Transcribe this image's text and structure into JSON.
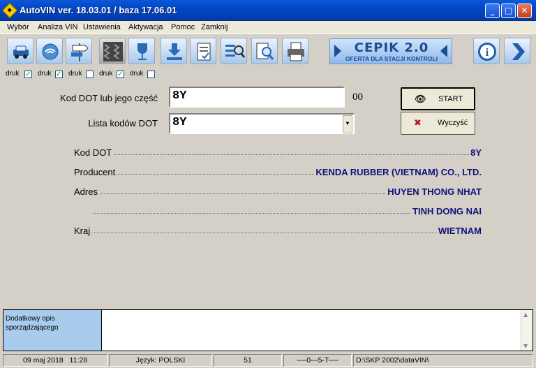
{
  "window": {
    "title": "AutoVIN ver. 18.03.01 / baza 17.06.01",
    "minimize": "_",
    "maximize": "□",
    "close": "✕"
  },
  "menu": [
    {
      "label": "Wybór",
      "name": "menu-wybor"
    },
    {
      "label": "Analiza VIN",
      "name": "menu-analiza-vin"
    },
    {
      "label": "Ustawienia",
      "name": "menu-ustawienia"
    },
    {
      "label": "Aktywacja",
      "name": "menu-aktywacja"
    },
    {
      "label": "Pomoc",
      "name": "menu-pomoc"
    },
    {
      "label": "Zamknij",
      "name": "menu-zamknij"
    }
  ],
  "toolbar": {
    "icons": [
      "car-icon",
      "transponder-icon",
      "road-sign-icon",
      "tire-icon",
      "glass-icon",
      "download-icon",
      "document-check-icon",
      "list-search-icon",
      "document-search-icon",
      "printer-icon"
    ],
    "cepik_title": "CEPIK 2.0",
    "cepik_subtitle": "OFERTA DLA STACJI KONTROLI",
    "info_icon": "info-icon",
    "next_icon": "arrow-right-icon"
  },
  "druk": [
    {
      "label": "druk",
      "checked": true,
      "mark": "✓"
    },
    {
      "label": "druk",
      "checked": true,
      "mark": "✓"
    },
    {
      "label": "druk",
      "checked": false,
      "mark": ""
    },
    {
      "label": "druk",
      "checked": true,
      "mark": "✓"
    },
    {
      "label": "druk",
      "checked": false,
      "mark": ""
    }
  ],
  "form": {
    "dot_label": "Kod DOT lub jego część",
    "dot_value": "8Y",
    "dot_suffix": "00",
    "list_label": "Lista kodów DOT",
    "list_value": "8Y",
    "start_label": "START",
    "clear_label": "Wyczyść"
  },
  "results": [
    {
      "label": "Kod DOT",
      "value": "8Y"
    },
    {
      "label": "Producent",
      "value": "KENDA RUBBER (VIETNAM) CO., LTD."
    },
    {
      "label": "Adres",
      "value": "HUYEN THONG NHAT"
    },
    {
      "label": "",
      "value": "TINH DONG NAI"
    },
    {
      "label": "Kraj",
      "value": "WIETNAM"
    }
  ],
  "description": {
    "label": "Dodatkowy opis sporządzającego",
    "value": ""
  },
  "status": {
    "date": "09 maj 2018",
    "time": "11:28",
    "language": "Język: POLSKI",
    "count": "51",
    "code": "----0---5-T----",
    "path": "D:\\SKP 2002\\dataVIN\\"
  },
  "colors": {
    "title_bar": "#0347c6",
    "result_value": "#10107a",
    "desc_label_bg": "#a8ccee"
  }
}
